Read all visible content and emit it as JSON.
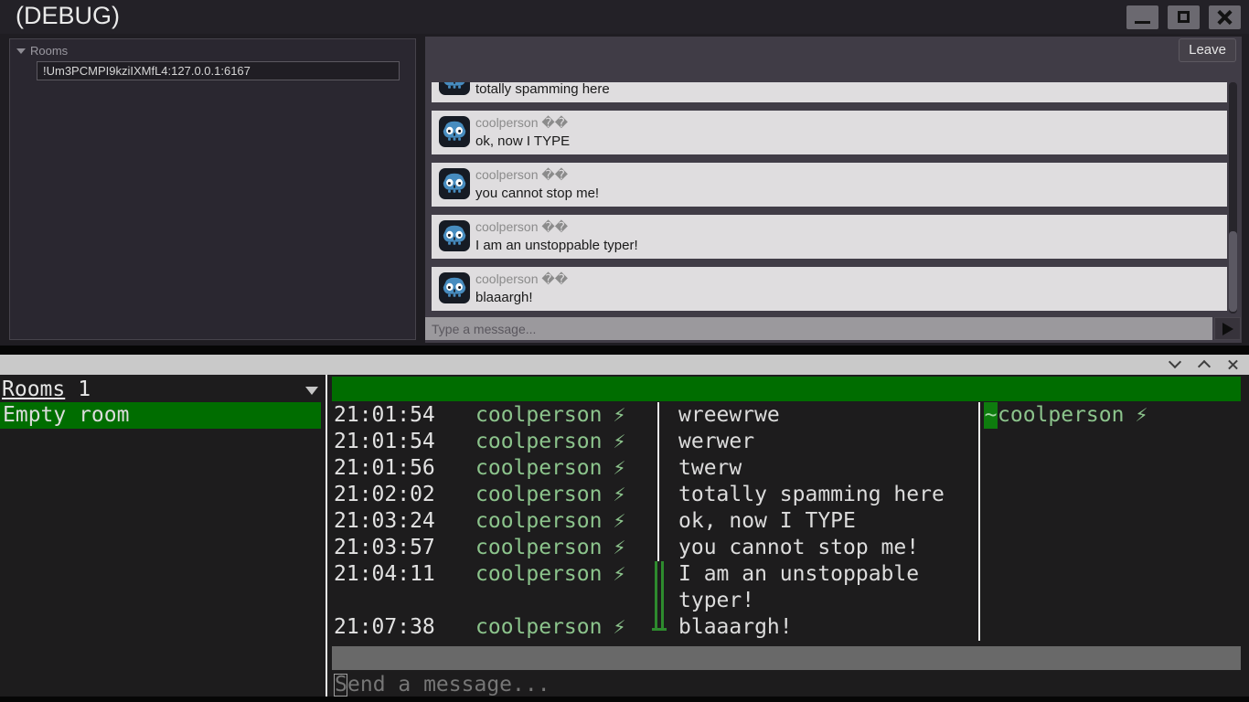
{
  "colors": {
    "green_dark": "#006d00",
    "green_bright": "#2e8b2e",
    "sender_green": "#8cc48c",
    "card_bg": "#dfdddf",
    "godot_blue": "#478cbf",
    "terminal_bg": "#1d1c1d",
    "chat_panel_bg": "#403c46"
  },
  "debug_window": {
    "title": "(DEBUG)",
    "controls": [
      {
        "icon": "minimize-icon"
      },
      {
        "icon": "maximize-icon"
      },
      {
        "icon": "close-icon"
      }
    ],
    "rooms_panel": {
      "tree_label": "Rooms",
      "tree_arrow_icon": "collapse-arrow-icon",
      "items": [
        {
          "text": "!Um3PCMPI9kziIXMfL4:127.0.0.1:6167"
        }
      ]
    },
    "chat_panel": {
      "leave_label": "Leave",
      "avatar_icon": "godot-robot-icon",
      "messages": [
        {
          "sender": "coolperson ��",
          "text": "totally spamming here",
          "partial": true
        },
        {
          "sender": "coolperson ��",
          "text": "ok, now I TYPE"
        },
        {
          "sender": "coolperson ��",
          "text": "you cannot stop me!"
        },
        {
          "sender": "coolperson ��",
          "text": "I am an unstoppable typer!"
        },
        {
          "sender": "coolperson ��",
          "text": "blaaargh!"
        }
      ],
      "input_placeholder": "Type a message...",
      "send_icon": "send-arrow-icon"
    }
  },
  "terminal_panel": {
    "titlebar_icons": [
      "chevron-down-icon",
      "chevron-up-icon",
      "close-icon"
    ],
    "rooms_header": {
      "label": "Rooms",
      "count": "1",
      "dropdown_icon": "dropdown-arrow-icon"
    },
    "rooms": [
      {
        "name": "Empty room",
        "selected": true
      }
    ],
    "topic_text": "",
    "messages": [
      {
        "time": "21:01:54",
        "sender": "coolperson",
        "badge": "⚡",
        "sep": "bar",
        "text": "wreewrwe"
      },
      {
        "time": "21:01:54",
        "sender": "coolperson",
        "badge": "⚡",
        "sep": "bar",
        "text": "werwer"
      },
      {
        "time": "21:01:56",
        "sender": "coolperson",
        "badge": "⚡",
        "sep": "bar",
        "text": "twerw"
      },
      {
        "time": "21:02:02",
        "sender": "coolperson",
        "badge": "⚡",
        "sep": "bar",
        "text": "totally spamming here"
      },
      {
        "time": "21:03:24",
        "sender": "coolperson",
        "badge": "⚡",
        "sep": "bar",
        "text": "ok, now I TYPE"
      },
      {
        "time": "21:03:57",
        "sender": "coolperson",
        "badge": "⚡",
        "sep": "bar",
        "text": "you cannot stop me!"
      },
      {
        "time": "21:04:11",
        "sender": "coolperson",
        "badge": "⚡",
        "sep": "thumb",
        "text": "I am an unstoppable"
      },
      {
        "time": "",
        "sender": "",
        "badge": "",
        "sep": "thumb",
        "text": "typer!"
      },
      {
        "time": "21:07:38",
        "sender": "coolperson",
        "badge": "⚡",
        "sep": "thumb-end",
        "text": "blaaargh!"
      }
    ],
    "members": [
      {
        "prefix": "~",
        "name": "coolperson",
        "badge": "⚡"
      }
    ],
    "input": {
      "cursor_char": "S",
      "rest": "end a message..."
    }
  }
}
